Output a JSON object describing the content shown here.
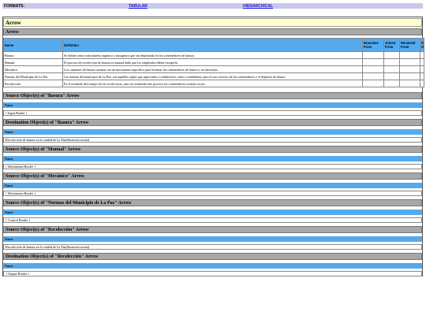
{
  "formats": {
    "label": "FORMATS:",
    "tabular": "TABULAR",
    "hierarchical": "HIERARCHICAL"
  },
  "title": "Arrow",
  "section_title": "Arrow",
  "table": {
    "headers": {
      "name": "Name",
      "definition": "Definition",
      "branches_from": "Branches From",
      "joined_from": "Joined From",
      "renamed_from": "Renamed From",
      "extra": "S O"
    },
    "rows": [
      {
        "name": "Basura",
        "definition": "Se define como toda materia organica o inorganica que sea depositada en los contenedores de basura"
      },
      {
        "name": "Manual",
        "definition": "El proceso de recoleccion de basura es manual dado que los empleados deben recogerla."
      },
      {
        "name": "Mecánico",
        "definition": "Los camiones de basura cuentan con un mecanismo específico para levantar los contenedores de basura y recolectarlos."
      },
      {
        "name": "Normas del Municipio de La Paz",
        "definition": "Las normas del municipio de La Paz, son aquellas reglas que rigen tanto a conductores como a ciudadanos, para el uso correcto de los contenedores y el depósito de basura."
      },
      {
        "name": "Recolección",
        "definition": "Es el resultado del trabajo de los recolectores, una vez realizado este proceso los contenedores estaran vacios."
      }
    ]
  },
  "sections": [
    {
      "title": "Source Object(s) of \"Basura\" Arrow",
      "name_label": "Name",
      "value": "{ Input Border }"
    },
    {
      "title": "Destination Object(s) of \"Basura\" Arrow",
      "name_label": "Name",
      "value": "Recolección de basura en la cuidad de La Paz(Situación actual)"
    },
    {
      "title": "Source Object(s) of \"Manual\" Arrow",
      "name_label": "Name",
      "value": "{ Mechanism Border }"
    },
    {
      "title": "Source Object(s) of \"Mecánico\" Arrow",
      "name_label": "Name",
      "value": "{ Mechanism Border }"
    },
    {
      "title": "Source Object(s) of \"Normas del Municipio de La Paz\" Arrow",
      "name_label": "Name",
      "value": "{ Control Border }"
    },
    {
      "title": "Source Object(s) of \"Recolección\" Arrow",
      "name_label": "Name",
      "value": "Recolección de basura en la cuidad de La Paz(Situación actual)"
    },
    {
      "title": "Destination Object(s) of \"Recolección\" Arrow",
      "name_label": "Name",
      "value": "{ Output Border }"
    }
  ]
}
